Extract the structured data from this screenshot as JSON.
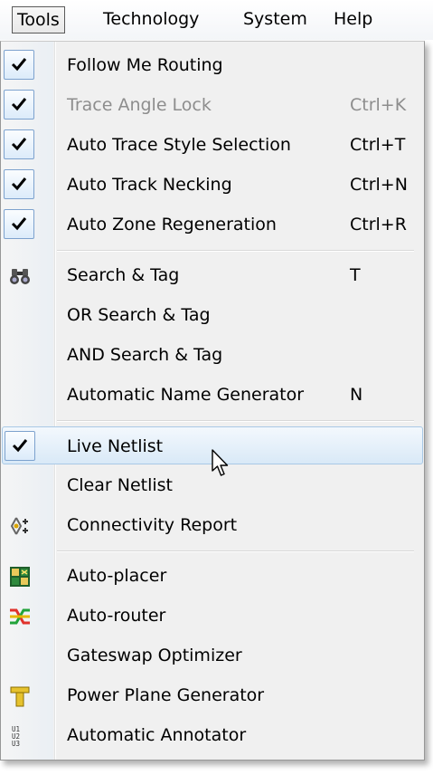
{
  "menubar": {
    "items": [
      {
        "label": "Tools",
        "active": true
      },
      {
        "label": "Technology"
      },
      {
        "label": "System"
      },
      {
        "label": "Help"
      }
    ]
  },
  "dropdown": {
    "items": [
      {
        "label": "Follow Me Routing",
        "shortcut": "",
        "checked": true
      },
      {
        "label": "Trace Angle Lock",
        "shortcut": "Ctrl+K",
        "checked": true,
        "disabled": true
      },
      {
        "label": "Auto Trace Style Selection",
        "shortcut": "Ctrl+T",
        "checked": true
      },
      {
        "label": "Auto Track Necking",
        "shortcut": "Ctrl+N",
        "checked": true
      },
      {
        "label": "Auto Zone Regeneration",
        "shortcut": "Ctrl+R",
        "checked": true
      },
      {
        "label": "Search & Tag",
        "shortcut": "T",
        "icon": "binoculars-icon"
      },
      {
        "label": "OR Search & Tag",
        "shortcut": ""
      },
      {
        "label": "AND Search & Tag",
        "shortcut": ""
      },
      {
        "label": "Automatic Name Generator",
        "shortcut": "N"
      },
      {
        "label": "Live Netlist",
        "shortcut": "",
        "checked": true,
        "hovered": true
      },
      {
        "label": "Clear Netlist",
        "shortcut": ""
      },
      {
        "label": "Connectivity Report",
        "shortcut": "",
        "icon": "connectivity-icon"
      },
      {
        "label": "Auto-placer",
        "shortcut": "",
        "icon": "auto-placer-icon"
      },
      {
        "label": "Auto-router",
        "shortcut": "",
        "icon": "auto-router-icon"
      },
      {
        "label": "Gateswap Optimizer",
        "shortcut": ""
      },
      {
        "label": "Power Plane Generator",
        "shortcut": "",
        "icon": "power-plane-icon"
      },
      {
        "label": "Automatic Annotator",
        "shortcut": "",
        "icon": "annotator-icon"
      }
    ]
  },
  "annotator_icon_text": {
    "line1": "U1",
    "line2": "U2",
    "line3": "U3"
  },
  "colors": {
    "hover_border": "#a9c9e6",
    "hover_fill": "#d9e9f7",
    "checkbox_border": "#7da2ce",
    "disabled_text": "#8d8d8d"
  }
}
